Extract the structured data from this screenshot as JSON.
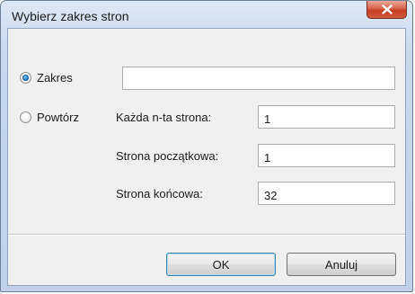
{
  "window": {
    "title": "Wybierz zakres stron",
    "close_icon": "close-icon",
    "accent_close_color": "#c84a30"
  },
  "range": {
    "radio_label": "Zakres",
    "selected": true,
    "value": ""
  },
  "repeat": {
    "radio_label": "Powtórz",
    "selected": false,
    "every_nth_label": "Każda n-ta strona:",
    "every_nth_value": "1",
    "start_page_label": "Strona początkowa:",
    "start_page_value": "1",
    "end_page_label": "Strona końcowa:",
    "end_page_value": "32"
  },
  "buttons": {
    "ok": "OK",
    "cancel": "Anuluj"
  }
}
